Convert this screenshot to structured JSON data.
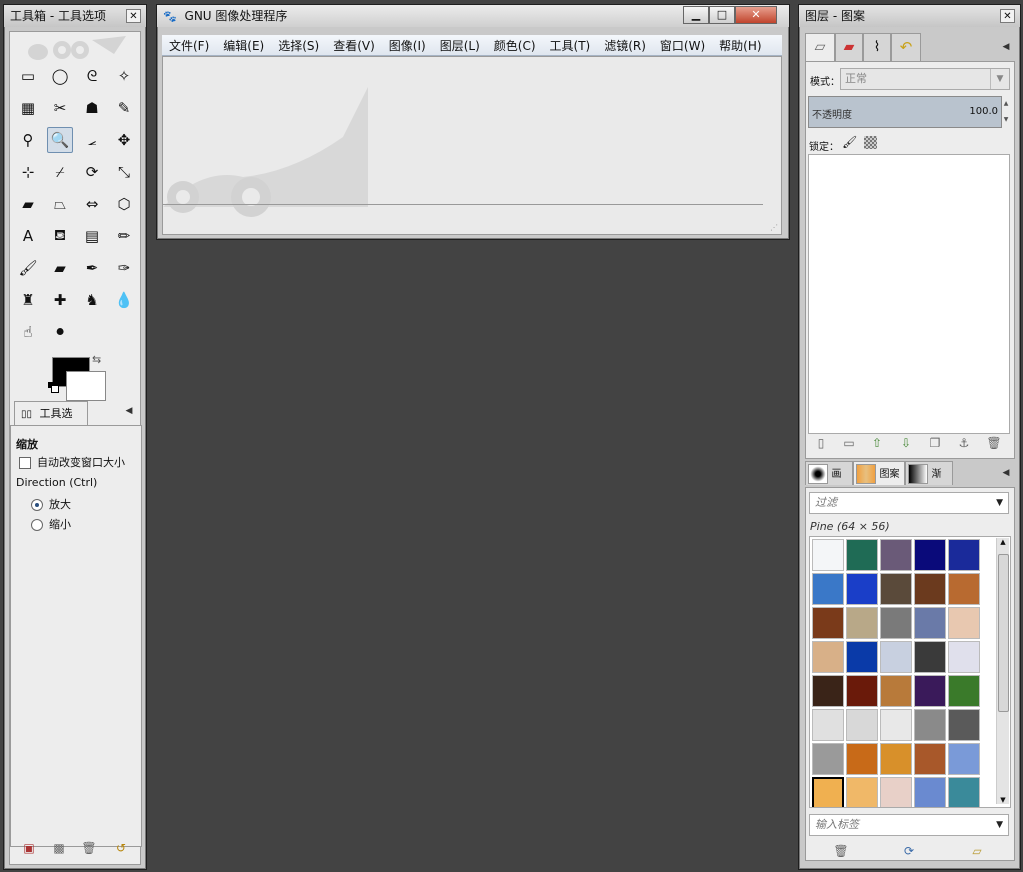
{
  "toolbox": {
    "title": "工具箱 - 工具选项",
    "close_glyph": "✕",
    "tools": [
      {
        "name": "rect-select-icon",
        "glyph": "▭"
      },
      {
        "name": "ellipse-select-icon",
        "glyph": "◯"
      },
      {
        "name": "free-select-icon",
        "glyph": "ᘓ"
      },
      {
        "name": "fuzzy-select-icon",
        "glyph": "✧"
      },
      {
        "name": "select-by-color-icon",
        "glyph": "▦"
      },
      {
        "name": "scissors-icon",
        "glyph": "✂"
      },
      {
        "name": "foreground-select-icon",
        "glyph": "☗"
      },
      {
        "name": "paths-icon",
        "glyph": "✎"
      },
      {
        "name": "color-picker-icon",
        "glyph": "⚲"
      },
      {
        "name": "zoom-icon",
        "glyph": "🔍"
      },
      {
        "name": "measure-icon",
        "glyph": "⦟"
      },
      {
        "name": "move-icon",
        "glyph": "✥"
      },
      {
        "name": "align-icon",
        "glyph": "⊹"
      },
      {
        "name": "crop-icon",
        "glyph": "⌿"
      },
      {
        "name": "rotate-icon",
        "glyph": "⟳"
      },
      {
        "name": "scale-icon",
        "glyph": "⤡"
      },
      {
        "name": "shear-icon",
        "glyph": "▰"
      },
      {
        "name": "perspective-icon",
        "glyph": "⏢"
      },
      {
        "name": "flip-icon",
        "glyph": "⇔"
      },
      {
        "name": "cage-icon",
        "glyph": "⬡"
      },
      {
        "name": "text-icon",
        "glyph": "A"
      },
      {
        "name": "bucket-fill-icon",
        "glyph": "⛾"
      },
      {
        "name": "blend-icon",
        "glyph": "▤"
      },
      {
        "name": "pencil-icon",
        "glyph": "✏"
      },
      {
        "name": "paintbrush-icon",
        "glyph": "🖌"
      },
      {
        "name": "eraser-icon",
        "glyph": "▰"
      },
      {
        "name": "airbrush-icon",
        "glyph": "✒"
      },
      {
        "name": "ink-icon",
        "glyph": "✑"
      },
      {
        "name": "clone-icon",
        "glyph": "♜"
      },
      {
        "name": "heal-icon",
        "glyph": "✚"
      },
      {
        "name": "perspective-clone-icon",
        "glyph": "♞"
      },
      {
        "name": "blur-icon",
        "glyph": "💧"
      },
      {
        "name": "smudge-icon",
        "glyph": "☝"
      },
      {
        "name": "dodge-burn-icon",
        "glyph": "⚫"
      }
    ],
    "tab_label": "工具选项",
    "options_heading": "缩放",
    "auto_resize_label": "自动改变窗口大小",
    "direction_label": "Direction  (Ctrl)",
    "zoom_in_label": "放大",
    "zoom_out_label": "缩小"
  },
  "main_window": {
    "title": "GNU 图像处理程序",
    "minimize_glyph": "▁",
    "maximize_glyph": "□",
    "close_glyph": "✕",
    "menus": [
      "文件(F)",
      "编辑(E)",
      "选择(S)",
      "查看(V)",
      "图像(I)",
      "图层(L)",
      "颜色(C)",
      "工具(T)",
      "滤镜(R)",
      "窗口(W)",
      "帮助(H)"
    ]
  },
  "layers_dock": {
    "title": "图层 - 图案",
    "close_glyph": "✕",
    "mode_label": "模式：",
    "mode_value": "正常",
    "opacity_label": "不透明度",
    "opacity_value": "100.0",
    "lock_label": "锁定：",
    "bottom_tabs": [
      "画笔",
      "图案",
      "渐变"
    ],
    "filter_placeholder": "过滤",
    "pattern_name": "Pine (64 × 56)",
    "tag_placeholder": "输入标签",
    "patterns": [
      "#f4f6f8",
      "#1f6b55",
      "#6a5a78",
      "#0a0a7a",
      "#1a2a9a",
      "#3a78c8",
      "#1a3ec8",
      "#5a4a3a",
      "#6b3a1e",
      "#b86a30",
      "#7a3a1a",
      "#b8a888",
      "#7a7a7a",
      "#6a7aa8",
      "#e8c8b0",
      "#d8b088",
      "#0a3aa8",
      "#c8d0e0",
      "#3a3a3a",
      "#e0e0ec",
      "#3a2418",
      "#6a1a0a",
      "#b87a3a",
      "#3a1a5a",
      "#3a7a2a",
      "#e0e0e0",
      "#d8d8d8",
      "#e8e8e8",
      "#8a8a8a",
      "#5a5a5a",
      "#9a9a9a",
      "#c86a18",
      "#d8902a",
      "#a8582a",
      "#7a9ad8",
      "#f0b050",
      "#f0b868",
      "#e8d0c8",
      "#6a8ad0",
      "#3a8a9a"
    ]
  }
}
